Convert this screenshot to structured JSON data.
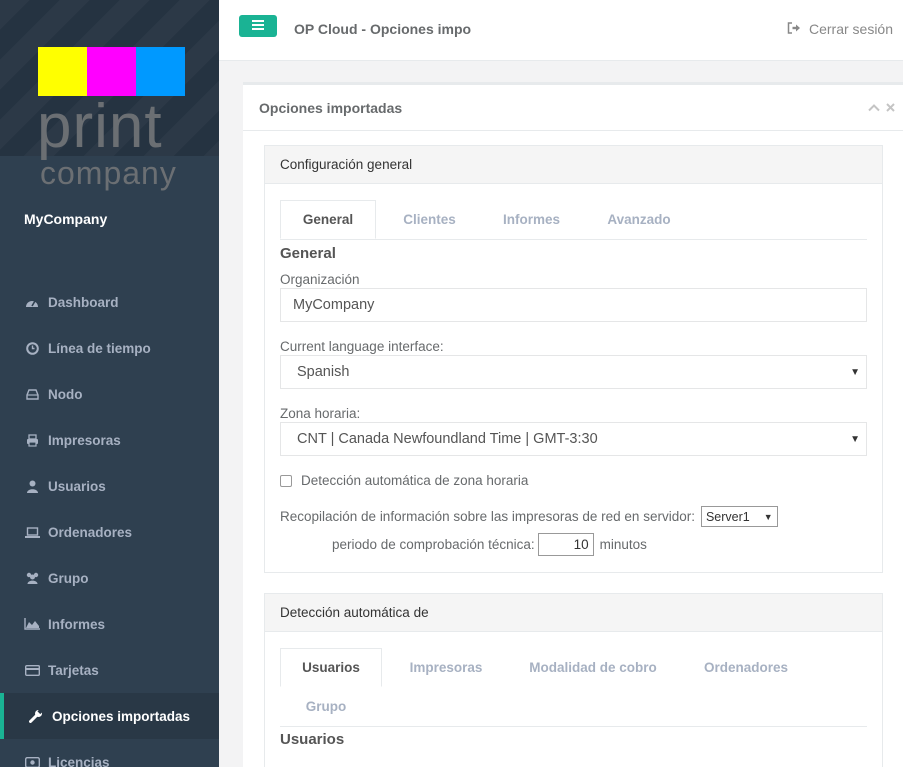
{
  "colors": {
    "sidebar": "#2f4050",
    "accent": "#1ab394",
    "logo_yellow": "#ffff00",
    "logo_magenta": "#ff00ff",
    "logo_blue": "#0099ff"
  },
  "brand": {
    "logo_word1": "print",
    "logo_word2": "company",
    "company_name": "MyCompany"
  },
  "sidebar": {
    "items": [
      {
        "label": "Dashboard",
        "icon": "dashboard-icon"
      },
      {
        "label": "Línea de tiempo",
        "icon": "clock-icon"
      },
      {
        "label": "Nodo",
        "icon": "hdd-icon"
      },
      {
        "label": "Impresoras",
        "icon": "printer-icon"
      },
      {
        "label": "Usuarios",
        "icon": "user-icon"
      },
      {
        "label": "Ordenadores",
        "icon": "laptop-icon"
      },
      {
        "label": "Grupo",
        "icon": "users-icon"
      },
      {
        "label": "Informes",
        "icon": "area-chart-icon"
      },
      {
        "label": "Tarjetas",
        "icon": "credit-card-icon"
      },
      {
        "label": "Opciones importadas",
        "icon": "wrench-icon",
        "active": true
      },
      {
        "label": "Licencias",
        "icon": "license-icon"
      }
    ]
  },
  "header": {
    "title": "OP Cloud - Opciones importadas",
    "logout_label": "Cerrar sesión"
  },
  "main": {
    "ibox_title": "Opciones importadas",
    "general_panel": {
      "heading": "Configuración general",
      "tabs": [
        "General",
        "Clientes",
        "Informes",
        "Avanzado"
      ],
      "section_title": "General",
      "org_label": "Organización",
      "org_value": "MyCompany",
      "lang_label": "Current language interface:",
      "lang_value": "Spanish",
      "tz_label": "Zona horaria:",
      "tz_value": "CNT | Canada Newfoundland Time | GMT-3:30",
      "auto_tz_label": "Detección automática de zona horaria",
      "collect_label": "Recopilación de información sobre las impresoras de red en servidor:",
      "server_value": "Server1",
      "period_label": "periodo de comprobación técnica:",
      "period_value": "10",
      "period_unit": "minutos"
    },
    "detect_panel": {
      "heading": "Detección automática de",
      "tabs": [
        "Usuarios",
        "Impresoras",
        "Modalidad de cobro",
        "Ordenadores",
        "Grupo"
      ],
      "section_title": "Usuarios"
    }
  }
}
